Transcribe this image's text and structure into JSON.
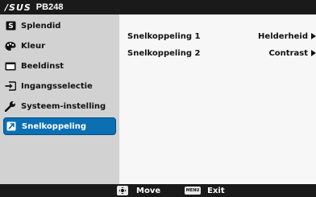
{
  "header": {
    "brand": "/SUS",
    "model": "PB248"
  },
  "sidebar": {
    "items": [
      {
        "label": "Splendid",
        "icon": "splendid-icon"
      },
      {
        "label": "Kleur",
        "icon": "color-palette-icon"
      },
      {
        "label": "Beeldinst",
        "icon": "picture-icon"
      },
      {
        "label": "Ingangsselectie",
        "icon": "input-select-icon"
      },
      {
        "label": "Systeem-instelling",
        "icon": "wrench-icon"
      },
      {
        "label": "Snelkoppeling",
        "icon": "shortcut-icon",
        "active": true
      }
    ]
  },
  "content": {
    "rows": [
      {
        "label": "Snelkoppeling 1",
        "value": "Helderheid"
      },
      {
        "label": "Snelkoppeling 2",
        "value": "Contrast"
      }
    ]
  },
  "footer": {
    "move_label": "Move",
    "menu_key": "MENU",
    "exit_label": "Exit"
  },
  "colors": {
    "header": "#1a1a1a",
    "sidebar": "#d2d2d2",
    "active": "#0b6fb3",
    "content": "#f7f7f7"
  }
}
